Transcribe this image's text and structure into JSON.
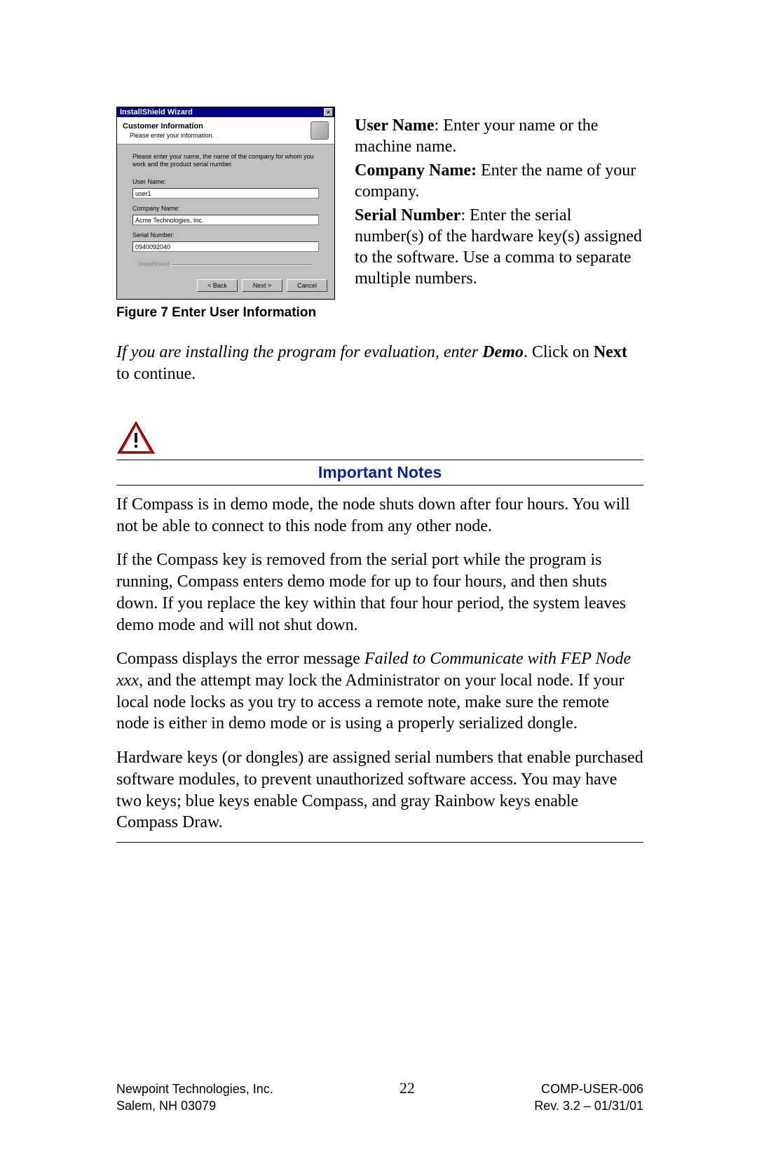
{
  "wizard": {
    "title": "InstallShield Wizard",
    "header_title": "Customer Information",
    "header_sub": "Please enter your information.",
    "prompt": "Please enter your name, the name of the company for whom you work and the product serial number.",
    "fields": {
      "user_label": "User Name:",
      "user_value": "user1",
      "company_label": "Company Name:",
      "company_value": "Acme Technologies, Inc.",
      "serial_label": "Serial Number:",
      "serial_value": "0940092040"
    },
    "brand": "InstallShield",
    "buttons": {
      "back": "< Back",
      "next": "Next >",
      "cancel": "Cancel"
    }
  },
  "right": {
    "user_bold": "User Name",
    "user_text": ": Enter your name or the machine name.",
    "company_bold": "Company Name:",
    "company_text": " Enter the name of your company.",
    "serial_bold": "Serial Number",
    "serial_text": ": Enter the serial number(s) of the hardware key(s) assigned to the software. Use a comma to separate multiple numbers."
  },
  "figure_caption": "Figure 7 Enter User Information",
  "eval": {
    "ital": "If you are installing the program for evaluation, enter ",
    "demo": "Demo",
    "tail1": ". Click on ",
    "next": "Next",
    "tail2": " to continue."
  },
  "important_title": "Important Notes",
  "notes": {
    "p1": "If Compass is in demo mode, the node shuts down after four hours. You will not be able to connect to this node from any other node.",
    "p2": "If the Compass key is removed from the serial port while the program is running, Compass enters demo mode for up to four hours, and then shuts down. If you replace the key within that four hour period, the system leaves demo mode and will not shut down.",
    "p3a": "Compass displays the error message ",
    "p3i": "Failed to Communicate with FEP Node xxx",
    "p3b": ", and the attempt may lock the Administrator on your local node. If your local node locks as you try to access a remote note, make sure the remote node is either in demo mode or is using a properly serialized dongle.",
    "p4": "Hardware keys (or dongles) are assigned serial numbers that enable purchased software modules, to prevent unauthorized software access. You may have two keys; blue keys enable Compass, and gray Rainbow keys enable Compass Draw."
  },
  "footer": {
    "company": "Newpoint Technologies, Inc.",
    "page": "22",
    "doc": "COMP-USER-006",
    "city": "Salem, NH 03079",
    "rev": "Rev. 3.2 – 01/31/01"
  }
}
